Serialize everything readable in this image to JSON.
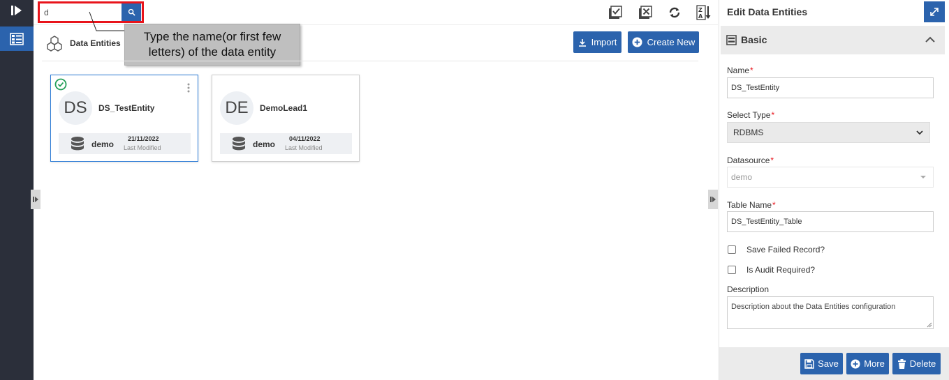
{
  "colors": {
    "accent": "#2b63ad",
    "highlight": "#e8141b",
    "nav_bg": "#2b2f3a",
    "success": "#26a05a"
  },
  "nav": {
    "logo_icon": "play-bar-icon",
    "active_icon": "list-grid-icon"
  },
  "search": {
    "value": "d",
    "icon": "search-icon"
  },
  "toolbar": {
    "icons": [
      "check-all-icon",
      "uncheck-all-icon",
      "refresh-icon",
      "sort-az-icon"
    ]
  },
  "callout": {
    "text": "Type the name(or first few letters) of the data entity"
  },
  "header": {
    "title": "Data Entities",
    "import_label": "Import",
    "create_label": "Create New"
  },
  "cards": [
    {
      "initials": "DS",
      "name": "DS_TestEntity",
      "datasource": "demo",
      "date": "21/11/2022",
      "modified_label": "Last Modified",
      "selected": true
    },
    {
      "initials": "DE",
      "name": "DemoLead1",
      "datasource": "demo",
      "date": "04/11/2022",
      "modified_label": "Last Modified",
      "selected": false
    }
  ],
  "panel": {
    "title": "Edit Data Entities",
    "section_title": "Basic",
    "fields": {
      "name_label": "Name",
      "name_value": "DS_TestEntity",
      "type_label": "Select Type",
      "type_value": "RDBMS",
      "datasource_label": "Datasource",
      "datasource_value": "demo",
      "table_label": "Table Name",
      "table_value": "DS_TestEntity_Table",
      "required_mark": "*"
    },
    "checkboxes": {
      "save_failed": "Save Failed Record?",
      "audit": "Is Audit Required?"
    },
    "description_label": "Description",
    "description_value": "Description about the Data Entities configuration",
    "buttons": {
      "save": "Save",
      "more": "More",
      "delete": "Delete"
    }
  }
}
